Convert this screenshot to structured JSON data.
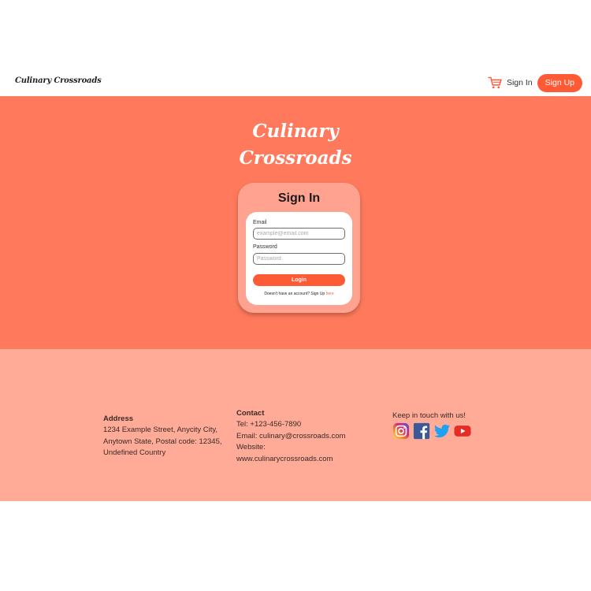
{
  "navbar": {
    "brand": "Culinary Crossroads",
    "cart_icon": "cart-icon",
    "signin_label": "Sign In",
    "signup_label": "Sign Up"
  },
  "hero": {
    "title_line1": "Culinary",
    "title_line2": "Crossroads"
  },
  "signin_card": {
    "title": "Sign In",
    "email_label": "Email",
    "email_placeholder": "example@email.com",
    "email_value": "",
    "password_label": "Password",
    "password_placeholder": "Password",
    "password_value": "",
    "login_label": "Login",
    "signup_prompt": "Doesn't have an account? Sign Up ",
    "signup_link": "here"
  },
  "footer": {
    "address_heading": "Address",
    "address_line1": "1234 Example Street, Anycity City,",
    "address_line2": "Anytown State, Postal code: 12345,",
    "address_line3": "Undefined Country",
    "contact_heading": "Contact",
    "contact_tel": "Tel: +123-456-7890",
    "contact_email": "Email: culinary@crossroads.com",
    "contact_website_label": "Website:",
    "contact_website": "www.culinarycrossroads.com",
    "social_heading": "Keep in touch with us!",
    "social_icons": [
      "instagram-icon",
      "facebook-icon",
      "twitter-icon",
      "youtube-icon"
    ]
  },
  "colors": {
    "accent": "#ff5a36",
    "hero_bg": "#ff7a5c",
    "card_bg": "#ffa28f",
    "footer_bg": "#ffab98"
  }
}
